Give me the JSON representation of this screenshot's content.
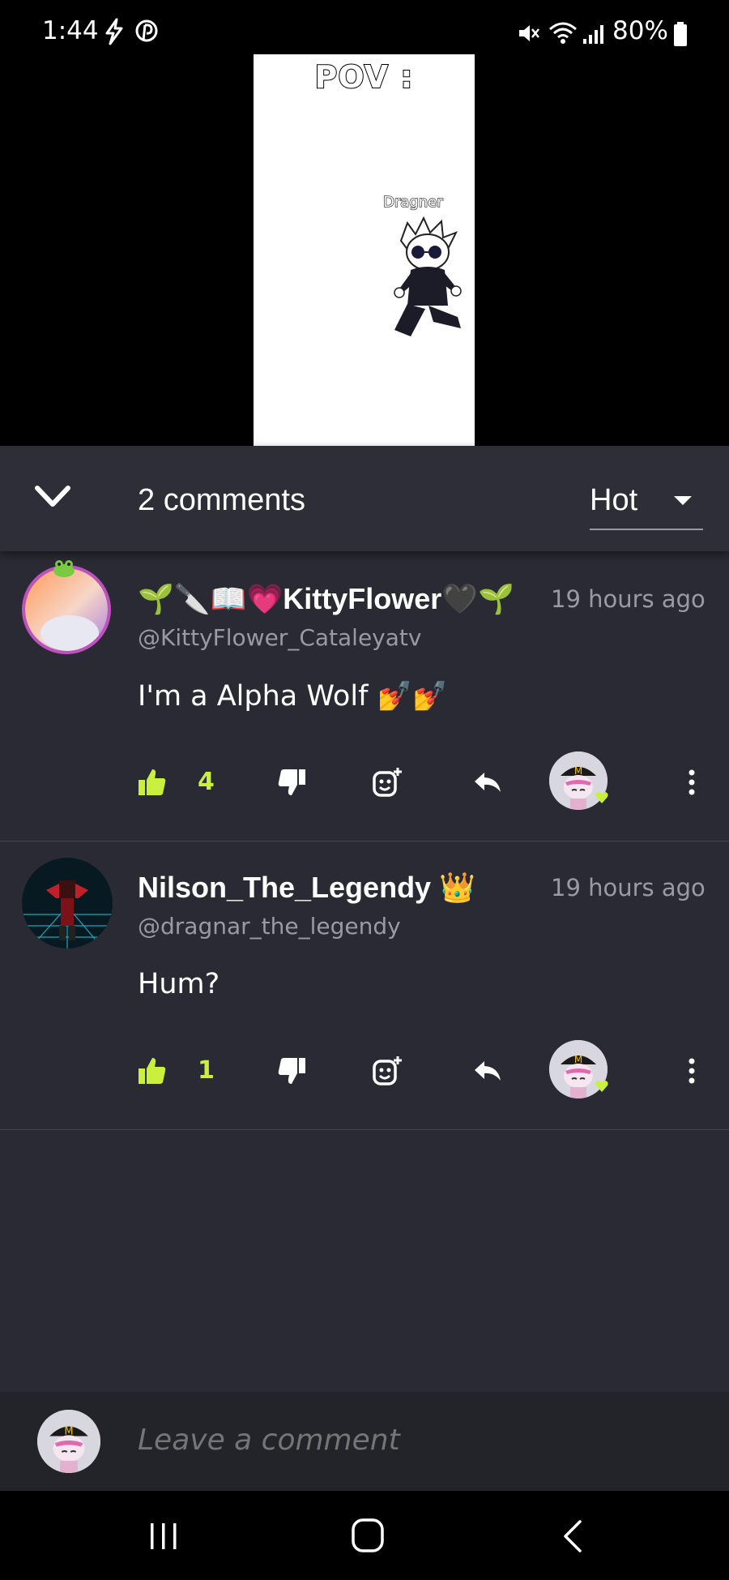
{
  "status_bar": {
    "time": "1:44",
    "battery": "80%",
    "icons": [
      "bolt-icon",
      "pinterest-icon",
      "mute-icon",
      "wifi-icon",
      "signal-icon",
      "battery-icon"
    ]
  },
  "video": {
    "overlay_text": "POV :",
    "character_label": "Dragner"
  },
  "comments_header": {
    "count_label": "2 comments",
    "sort_label": "Hot"
  },
  "comments": [
    {
      "author": "🌱🔪📖💗KittyFlower🖤🌱",
      "handle": "@KittyFlower_Cataleyatv",
      "time": "19 hours ago",
      "text": "I'm a Alpha Wolf 💅💅",
      "likes": "4"
    },
    {
      "author": "Nilson_The_Legendy 👑",
      "handle": "@dragnar_the_legendy",
      "time": "19 hours ago",
      "text": "Hum?",
      "likes": "1"
    }
  ],
  "composer": {
    "placeholder": "Leave a comment"
  },
  "colors": {
    "background": "#2a2a34",
    "accent": "#c8f03c",
    "muted_text": "#9a9aa4"
  }
}
